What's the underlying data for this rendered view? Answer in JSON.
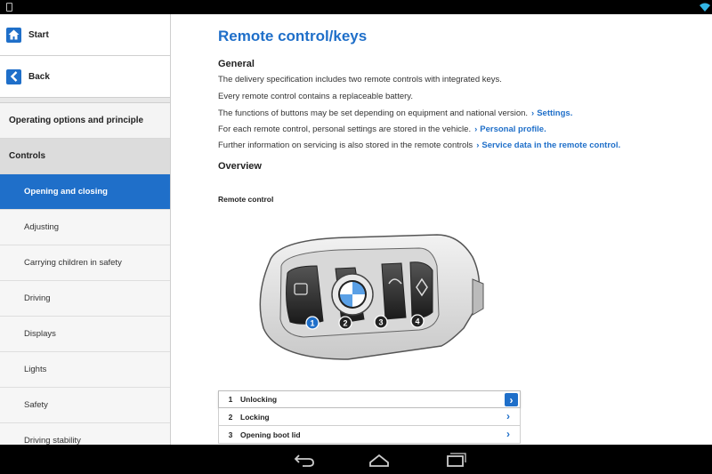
{
  "sidebar": {
    "start_label": "Start",
    "back_label": "Back",
    "sections": [
      "Operating options and principle",
      "Controls"
    ],
    "items": [
      {
        "label": "Opening and closing",
        "active": true
      },
      {
        "label": "Adjusting",
        "active": false
      },
      {
        "label": "Carrying children in safety",
        "active": false
      },
      {
        "label": "Driving",
        "active": false
      },
      {
        "label": "Displays",
        "active": false
      },
      {
        "label": "Lights",
        "active": false
      },
      {
        "label": "Safety",
        "active": false
      },
      {
        "label": "Driving stability",
        "active": false
      }
    ]
  },
  "content": {
    "title": "Remote control/keys",
    "general_heading": "General",
    "para1": "The delivery specification includes two remote controls with integrated keys.",
    "para2": "Every remote control contains a replaceable battery.",
    "para3": "The functions of buttons may be set depending on equipment and national version.",
    "para3_link": "Settings.",
    "para4": "For each remote control, personal settings are stored in the vehicle.",
    "para4_link": "Personal profile.",
    "para5": "Further information on servicing is also stored in the remote controls",
    "para5_link": "Service data in the remote control.",
    "overview_heading": "Overview",
    "figure_caption": "Remote control",
    "fob_callouts": [
      "1",
      "2",
      "3",
      "4"
    ],
    "list": [
      {
        "number": "1",
        "label": "Unlocking"
      },
      {
        "number": "2",
        "label": "Locking"
      },
      {
        "number": "3",
        "label": "Opening boot lid"
      }
    ]
  },
  "colors": {
    "accent": "#1f6fc9",
    "sidebar_bg": "#f4f4f4",
    "active_bg": "#1f6fc9"
  },
  "icons": {
    "start": "home-icon",
    "back": "back-arrow-icon",
    "list_arrow": "chevron-right-icon",
    "nav_back": "android-back-icon",
    "nav_home": "android-home-icon",
    "nav_recents": "android-recents-icon"
  }
}
